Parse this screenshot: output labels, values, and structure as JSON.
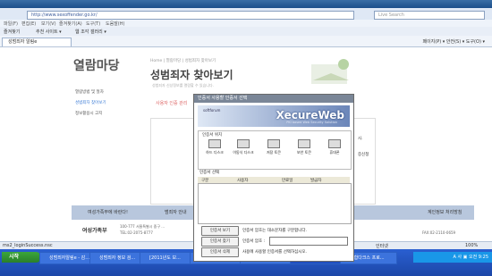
{
  "browser": {
    "url": "http://www.sexoffender.go.kr/",
    "search_placeholder": "Live Search",
    "menus": [
      "파일(F)",
      "편집(E)",
      "보기(V)",
      "즐겨찾기(A)",
      "도구(T)",
      "도움말(H)"
    ],
    "fav_label": "즐겨찾기",
    "fav_items": [
      "추천 사이트 ▾",
      "웹 조각 갤러리 ▾"
    ],
    "tab_title": "성범죄자 알림e",
    "tools": [
      "페이지(P) ▾",
      "안전(S) ▾",
      "도구(O) ▾"
    ]
  },
  "page": {
    "section_title": "열람마당",
    "left_nav": [
      "열람방법 및 절차",
      "성범죄자 찾아보기",
      "정보활용시 고지"
    ],
    "breadcrumb": "Home  |  열람마당  |  성범죄자 찾아보기",
    "heading": "성범죄자 찾아보기",
    "subheading": "성범죄자 신상정보를 열람할 수 있습니다.",
    "notice": "사용자 인증 관리",
    "right_text": "시.",
    "right_text2": "증신청",
    "footer_items": [
      "여성가족부에 바란다!",
      "범죄자 안내",
      "계인정보 처리방침"
    ],
    "footer_org": "여성가족부",
    "footer_addr": "100-777 서울특별시 중구 ...",
    "footer_tel": "TEL:02-2075-8777",
    "footer_fax": "FAX:02-2110-0659"
  },
  "status": {
    "left": "ms2_loginSuccess.nsc",
    "zone": "인터넷",
    "zoom": "100%"
  },
  "taskbar": {
    "start": "시작",
    "buttons": [
      "성범죄자알림e - 감...",
      "성범죄자 정보 검...",
      "[2011년도 보...",
      "Quickheil",
      "SECUREWORKS...",
      "성범죄자 알림e -...",
      "통합다크스 프로..."
    ],
    "tray": "A 사 ▣ 오전 9:25"
  },
  "dialog": {
    "title": "인증서 사용할 인증서 선택",
    "brand": "XecureWeb",
    "brand_small": "softforum",
    "brand_tag": "PKI based Web Security Solution",
    "location_label": "인증서 위치",
    "locations": [
      "하드 디스크",
      "이동식 디스크",
      "저장 토큰",
      "보안 토큰",
      "휴대폰"
    ],
    "list_label": "인증서 선택",
    "columns": [
      "구분",
      "사용자",
      "만료일",
      "발급자"
    ],
    "buttons": [
      "인증서 보기",
      "인증서 찾기",
      "인증서 삭제"
    ],
    "msg1": "인증서 암호는 대소문자를 구분합니다.",
    "pw_label": "인증서 암호 :",
    "msg2": "사용에 사용할 인증서를 선택하십시오."
  }
}
